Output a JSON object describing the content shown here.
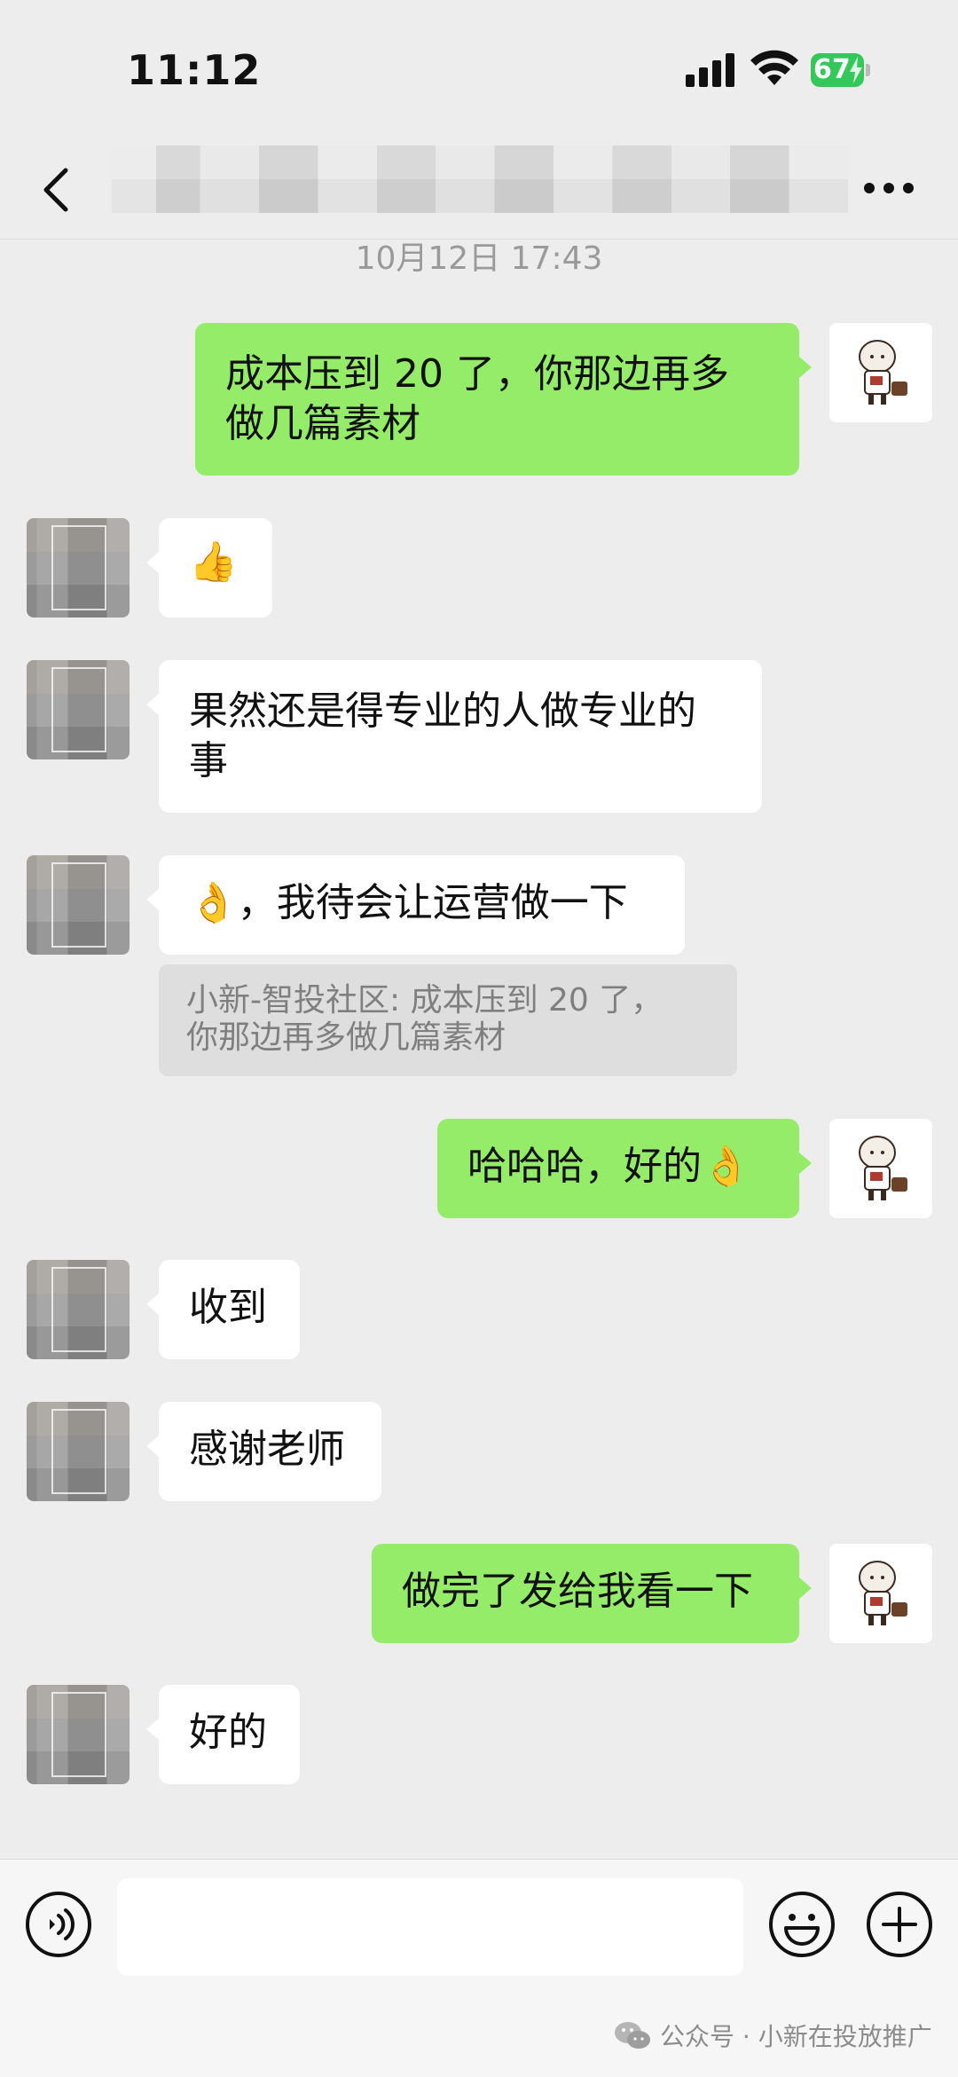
{
  "status_bar": {
    "time": "11:12",
    "battery": "67"
  },
  "nav": {
    "back_icon": "chevron-left-icon",
    "more_icon": "ellipsis-icon"
  },
  "timestamp": "10月12日 17:43",
  "messages": [
    {
      "side": "right",
      "text_lines": [
        "成本压到 20 了，你那边再多",
        "做几篇素材"
      ]
    },
    {
      "side": "left",
      "emoji": "👍"
    },
    {
      "side": "left",
      "text_lines": [
        "果然还是得专业的人做专业的",
        "事"
      ]
    },
    {
      "side": "left",
      "emoji": "👌",
      "text": "，我待会让运营做一下"
    },
    {
      "side": "right",
      "text": "哈哈哈，好的",
      "emoji": "👌"
    },
    {
      "side": "left",
      "text": "收到"
    },
    {
      "side": "left",
      "text": "感谢老师"
    },
    {
      "side": "right",
      "text": "做完了发给我看一下"
    },
    {
      "side": "left",
      "text": "好的"
    }
  ],
  "quote": {
    "lines": [
      "小新-智投社区: 成本压到 20 了，",
      "你那边再多做几篇素材"
    ]
  },
  "input_bar": {
    "voice_icon": "voice-icon",
    "emoji_icon": "emoji-icon",
    "plus_icon": "plus-icon"
  },
  "watermark": "公众号 · 小新在投放推广",
  "colors": {
    "background": "#ededed",
    "bubble_sent": "#95ec69",
    "bubble_received": "#ffffff",
    "battery": "#34c759"
  }
}
